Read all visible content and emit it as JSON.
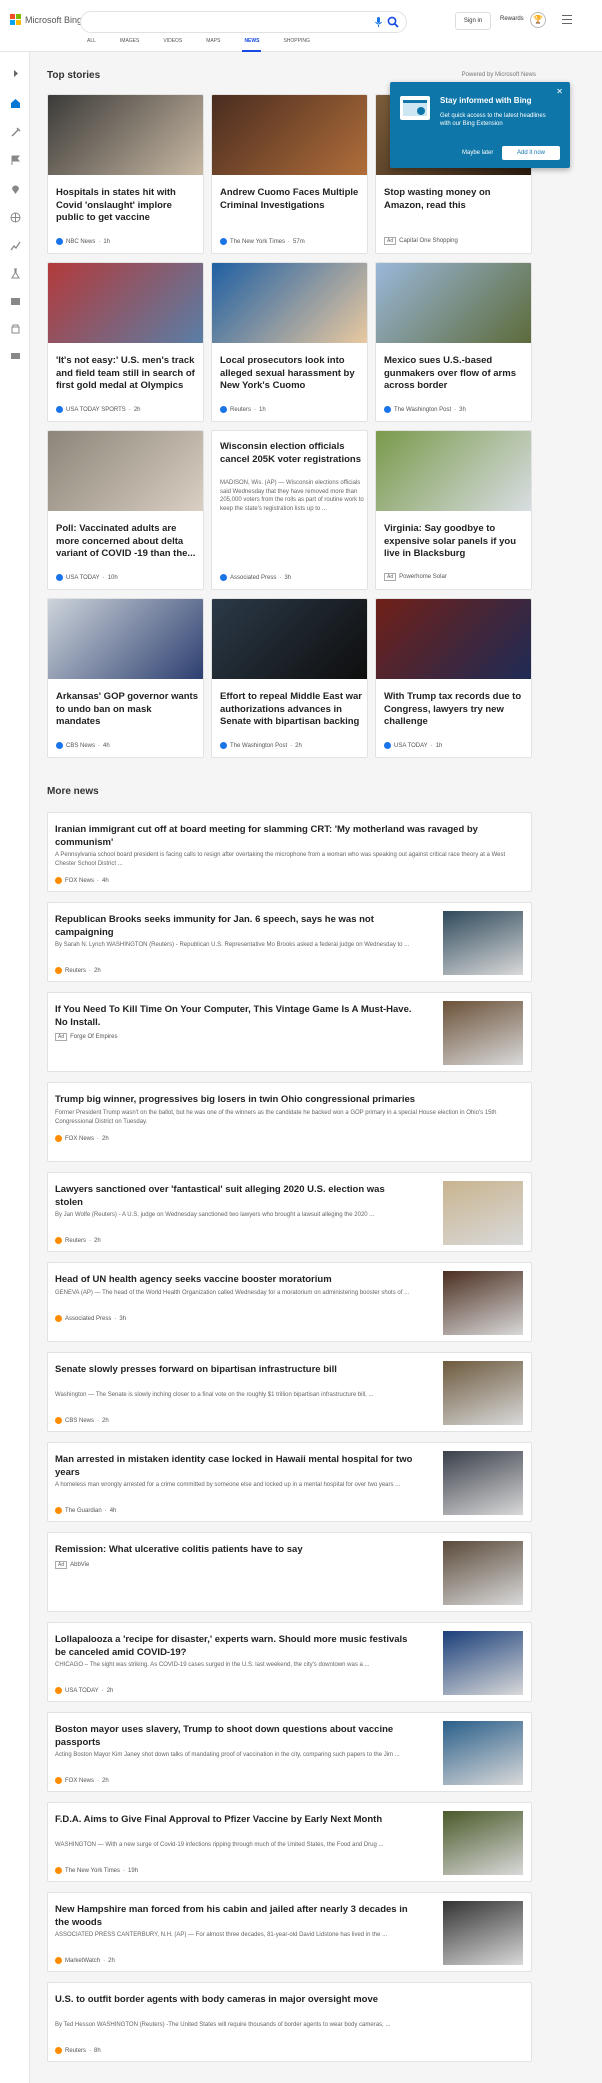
{
  "header": {
    "logo_text": "Microsoft Bing",
    "sign_in": "Sign in",
    "rewards": "Rewards",
    "tabs": [
      {
        "label": "ALL"
      },
      {
        "label": "IMAGES"
      },
      {
        "label": "VIDEOS"
      },
      {
        "label": "MAPS"
      },
      {
        "label": "NEWS",
        "active": true
      },
      {
        "label": "SHOPPING"
      }
    ]
  },
  "sidebar": {
    "icons": [
      "chevron-right-icon",
      "home-icon",
      "tools-icon",
      "flag-icon",
      "location-icon",
      "globe-icon",
      "chart-icon",
      "science-icon",
      "entertainment-icon",
      "sports-icon",
      "money-icon"
    ]
  },
  "top_stories": {
    "title": "Top stories",
    "powered": "Powered by Microsoft News",
    "cards": [
      {
        "title": "Hospitals in states hit with Covid 'onslaught' implore public to get vaccine",
        "source": "NBC News",
        "time": "1h",
        "snippet": "",
        "ad": false
      },
      {
        "title": "Andrew Cuomo Faces Multiple Criminal Investigations",
        "source": "The New York Times",
        "time": "57m",
        "snippet": "",
        "ad": false
      },
      {
        "title": "Stop wasting money on Amazon, read this",
        "source": "Capital One Shopping",
        "time": "",
        "snippet": "",
        "ad": true
      },
      {
        "title": "'It's not easy:' U.S. men's track and field team still in search of first gold medal at Olympics",
        "source": "USA TODAY SPORTS",
        "time": "2h",
        "snippet": "",
        "ad": false
      },
      {
        "title": "Local prosecutors look into alleged sexual harassment by New York's Cuomo",
        "source": "Reuters",
        "time": "1h",
        "snippet": "",
        "ad": false
      },
      {
        "title": "Mexico sues U.S.-based gunmakers over flow of arms across border",
        "source": "The Washington Post",
        "time": "3h",
        "snippet": "",
        "ad": false
      },
      {
        "title": "Poll: Vaccinated adults are more concerned about delta variant of COVID -19 than the...",
        "source": "USA TODAY",
        "time": "10h",
        "snippet": "",
        "ad": false
      },
      {
        "title": "Wisconsin election officials cancel 205K voter registrations",
        "source": "Associated Press",
        "time": "3h",
        "snippet": "MADISON, Wis. (AP) — Wisconsin elections officials said Wednesday that they have removed more than 205,000 voters from the rolls as part of routine work to keep the state's registration lists up to ...",
        "ad": false
      },
      {
        "title": "Virginia: Say goodbye to expensive solar panels if you live in Blacksburg",
        "source": "Powerhome Solar",
        "time": "",
        "snippet": "",
        "ad": true
      },
      {
        "title": "Arkansas' GOP governor wants to undo ban on mask mandates",
        "source": "CBS News",
        "time": "4h",
        "snippet": "",
        "ad": false
      },
      {
        "title": "Effort to repeal Middle East war authorizations advances in Senate with bipartisan backing",
        "source": "The Washington Post",
        "time": "2h",
        "snippet": "",
        "ad": false
      },
      {
        "title": "With Trump tax records due to Congress, lawyers try new challenge",
        "source": "USA TODAY",
        "time": "1h",
        "snippet": "",
        "ad": false
      }
    ]
  },
  "popup": {
    "title": "Stay informed with Bing",
    "body": "Get quick access to the latest headlines with our Bing Extension",
    "later": "Maybe later",
    "add": "Add it now",
    "close": "✕"
  },
  "more_news": {
    "title": "More news",
    "items": [
      {
        "title": "Iranian immigrant cut off at board meeting for slamming CRT: 'My motherland was ravaged by communism'",
        "snippet": "A Pennsylvania school board president is facing calls to resign after overtaking the microphone from a woman who was speaking out against critical race theory at a West Chester School District ...",
        "source": "FOX News",
        "time": "4h",
        "has_image": false,
        "ad": false
      },
      {
        "title": "Republican Brooks seeks immunity for Jan. 6 speech, says he was not campaigning",
        "snippet": "By Sarah N. Lynch WASHINGTON (Reuters) - Republican U.S. Representative Mo Brooks asked a federal judge on Wednesday to ...",
        "source": "Reuters",
        "time": "2h",
        "has_image": true,
        "ad": false
      },
      {
        "title": "If You Need To Kill Time On Your Computer, This Vintage Game Is A Must-Have. No Install.",
        "snippet": "",
        "source": "Forge Of Empires",
        "time": "",
        "has_image": true,
        "ad": true
      },
      {
        "title": "Trump big winner, progressives big losers in twin Ohio congressional primaries",
        "snippet": "Former President Trump wasn't on the ballot, but he was one of the winners as the candidate he backed won a GOP primary in a special House election in Ohio's 15th Congressional District on Tuesday.",
        "source": "FOX News",
        "time": "2h",
        "has_image": false,
        "ad": false
      },
      {
        "title": "Lawyers sanctioned over 'fantastical' suit alleging 2020 U.S. election was stolen",
        "snippet": "By Jan Wolfe (Reuters) - A U.S. judge on Wednesday sanctioned two lawyers who brought a lawsuit alleging the 2020 ...",
        "source": "Reuters",
        "time": "2h",
        "has_image": true,
        "ad": false
      },
      {
        "title": "Head of UN health agency seeks vaccine booster moratorium",
        "snippet": "GENEVA (AP) — The head of the World Health Organization called Wednesday for a moratorium on administering booster shots of ...",
        "source": "Associated Press",
        "time": "3h",
        "has_image": true,
        "ad": false
      },
      {
        "title": "Senate slowly presses forward on bipartisan infrastructure bill",
        "snippet": "Washington — The Senate is slowly inching closer to a final vote on the roughly $1 trillion bipartisan infrastructure bill, ...",
        "source": "CBS News",
        "time": "2h",
        "has_image": true,
        "ad": false
      },
      {
        "title": "Man arrested in mistaken identity case locked in Hawaii mental hospital for two years",
        "snippet": "A homeless man wrongly arrested for a crime committed by someone else and locked up in a mental hospital for over two years ...",
        "source": "The Guardian",
        "time": "4h",
        "has_image": true,
        "ad": false
      },
      {
        "title": "Remission: What ulcerative colitis patients have to say",
        "snippet": "",
        "source": "AbbVie",
        "time": "",
        "has_image": true,
        "ad": true
      },
      {
        "title": "Lollapalooza a 'recipe for disaster,' experts warn. Should more music festivals be canceled amid COVID-19?",
        "snippet": "CHICAGO – The sight was striking. As COVID-19 cases surged in the U.S. last weekend, the city's downtown was a ...",
        "source": "USA TODAY",
        "time": "2h",
        "has_image": true,
        "ad": false
      },
      {
        "title": "Boston mayor uses slavery, Trump to shoot down questions about vaccine passports",
        "snippet": "Acting Boston Mayor Kim Janey shot down talks of mandating proof of vaccination in the city, comparing such papers to the Jim ...",
        "source": "FOX News",
        "time": "2h",
        "has_image": true,
        "ad": false
      },
      {
        "title": "F.D.A. Aims to Give Final Approval to Pfizer Vaccine by Early Next Month",
        "snippet": "WASHINGTON — With a new surge of Covid-19 infections ripping through much of the United States, the Food and Drug ...",
        "source": "The New York Times",
        "time": "19h",
        "has_image": true,
        "ad": false
      },
      {
        "title": "New Hampshire man forced from his cabin and jailed after nearly 3 decades in the woods",
        "snippet": "ASSOCIATED PRESS CANTERBURY, N.H. (AP) — For almost three decades, 81-year-old David Lidstone has lived in the ...",
        "source": "MarketWatch",
        "time": "2h",
        "has_image": true,
        "ad": false
      },
      {
        "title": "U.S. to outfit border agents with body cameras in major oversight move",
        "snippet": "By Ted Hesson WASHINGTON (Reuters) -The United States will require thousands of border agents to wear body cameras, ...",
        "source": "Reuters",
        "time": "8h",
        "has_image": true,
        "ad": false
      }
    ]
  },
  "colors": {
    "accent": "#174ae4",
    "popup": "#0e76a8"
  }
}
